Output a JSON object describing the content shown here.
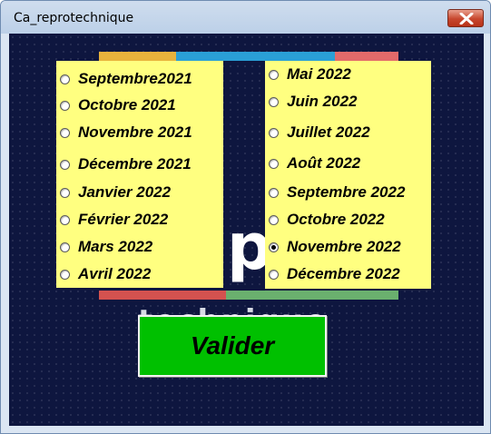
{
  "window": {
    "title": "Ca_reprotechnique",
    "close_icon": "close-x-icon"
  },
  "background": {
    "letter": "p",
    "word": "technique",
    "stripe_colors": [
      "#e8b23c",
      "#2a9fd6",
      "#e26a6a",
      "#d4524f",
      "#6ab06e"
    ]
  },
  "left_options": [
    {
      "label": "Septembre2021",
      "checked": false
    },
    {
      "label": "Octobre 2021",
      "checked": false
    },
    {
      "label": "Novembre 2021",
      "checked": false
    },
    {
      "label": "Décembre 2021",
      "checked": false
    },
    {
      "label": "Janvier 2022",
      "checked": false
    },
    {
      "label": "Février 2022",
      "checked": false
    },
    {
      "label": "Mars 2022",
      "checked": false
    },
    {
      "label": "Avril 2022",
      "checked": false
    }
  ],
  "right_options": [
    {
      "label": "Mai 2022",
      "checked": false
    },
    {
      "label": "Juin 2022",
      "checked": false
    },
    {
      "label": "Juillet 2022",
      "checked": false
    },
    {
      "label": "Août 2022",
      "checked": false
    },
    {
      "label": "Septembre 2022",
      "checked": false
    },
    {
      "label": "Octobre 2022",
      "checked": false
    },
    {
      "label": "Novembre 2022",
      "checked": true
    },
    {
      "label": "Décembre 2022",
      "checked": false
    }
  ],
  "submit": {
    "label": "Valider"
  },
  "colors": {
    "panel": "#ffff80",
    "button": "#00c000",
    "client_bg": "#0e163f"
  }
}
